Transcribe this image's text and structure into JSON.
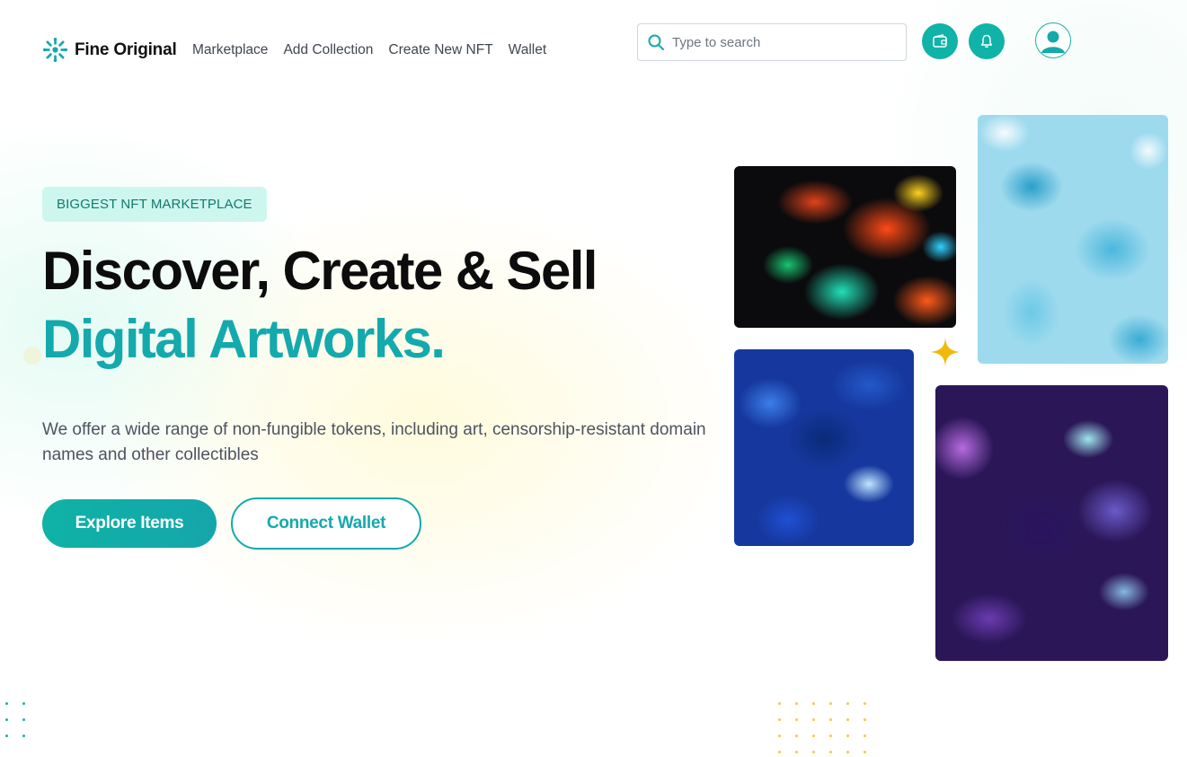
{
  "brand": {
    "name": "Fine Original",
    "accent_color": "#10b3a7",
    "logo_icon": "snowflake-burst-icon"
  },
  "nav": {
    "items": [
      {
        "label": "Marketplace"
      },
      {
        "label": "Add Collection"
      },
      {
        "label": "Create New NFT"
      },
      {
        "label": "Wallet"
      }
    ]
  },
  "search": {
    "placeholder": "Type to search",
    "value": "",
    "icon": "search-icon"
  },
  "header_actions": {
    "wallet_icon": "wallet-icon",
    "notification_icon": "bell-icon",
    "profile_icon": "user-avatar-icon"
  },
  "hero": {
    "badge": "BIGGEST NFT MARKETPLACE",
    "title_line1": "Discover, Create & Sell",
    "title_line2": "Digital Artworks.",
    "description": "We offer a wide range of non-fungible tokens, including art, censorship-resistant domain names and other collectibles",
    "primary_button": "Explore Items",
    "secondary_button": "Connect Wallet",
    "title_accent_color": "#14a9ad"
  },
  "gallery": {
    "artworks": [
      {
        "name": "fluid-abstract-art"
      },
      {
        "name": "watercolor-blue-art"
      },
      {
        "name": "blue-texture-art"
      },
      {
        "name": "purple-liquid-art"
      }
    ],
    "decoration_icon": "sparkle-icon"
  }
}
